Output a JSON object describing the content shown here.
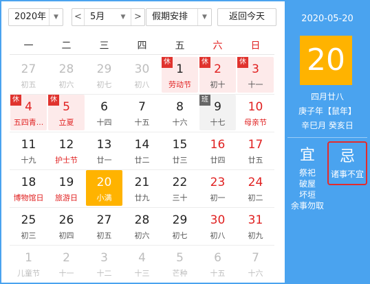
{
  "toolbar": {
    "year": "2020年",
    "prev": "<",
    "month": "5月",
    "next": ">",
    "holiday": "假期安排",
    "today": "返回今天"
  },
  "weekdays": [
    "一",
    "二",
    "三",
    "四",
    "五",
    "六",
    "日"
  ],
  "days": [
    {
      "n": "27",
      "l": "初五",
      "cls": "other"
    },
    {
      "n": "28",
      "l": "初六",
      "cls": "other"
    },
    {
      "n": "29",
      "l": "初七",
      "cls": "other"
    },
    {
      "n": "30",
      "l": "初八",
      "cls": "other"
    },
    {
      "n": "1",
      "l": "劳动节",
      "cls": "rest fest",
      "badge": "休"
    },
    {
      "n": "2",
      "l": "初十",
      "cls": "rest wknd",
      "badge": "休"
    },
    {
      "n": "3",
      "l": "十一",
      "cls": "rest wknd",
      "badge": "休"
    },
    {
      "n": "4",
      "l": "五四青...",
      "cls": "rest fest wknd-num",
      "badge": "休"
    },
    {
      "n": "5",
      "l": "立夏",
      "cls": "rest fest wknd-num",
      "badge": "休"
    },
    {
      "n": "6",
      "l": "十四",
      "cls": ""
    },
    {
      "n": "7",
      "l": "十五",
      "cls": ""
    },
    {
      "n": "8",
      "l": "十六",
      "cls": ""
    },
    {
      "n": "9",
      "l": "十七",
      "cls": "work",
      "badge": "班"
    },
    {
      "n": "10",
      "l": "母亲节",
      "cls": "wknd fest"
    },
    {
      "n": "11",
      "l": "十九",
      "cls": ""
    },
    {
      "n": "12",
      "l": "护士节",
      "cls": "fest"
    },
    {
      "n": "13",
      "l": "廿一",
      "cls": ""
    },
    {
      "n": "14",
      "l": "廿二",
      "cls": ""
    },
    {
      "n": "15",
      "l": "廿三",
      "cls": ""
    },
    {
      "n": "16",
      "l": "廿四",
      "cls": "wknd"
    },
    {
      "n": "17",
      "l": "廿五",
      "cls": "wknd"
    },
    {
      "n": "18",
      "l": "博物馆日",
      "cls": "fest"
    },
    {
      "n": "19",
      "l": "旅游日",
      "cls": "fest"
    },
    {
      "n": "20",
      "l": "小满",
      "cls": "today"
    },
    {
      "n": "21",
      "l": "廿九",
      "cls": ""
    },
    {
      "n": "22",
      "l": "三十",
      "cls": ""
    },
    {
      "n": "23",
      "l": "初一",
      "cls": "wknd"
    },
    {
      "n": "24",
      "l": "初二",
      "cls": "wknd"
    },
    {
      "n": "25",
      "l": "初三",
      "cls": ""
    },
    {
      "n": "26",
      "l": "初四",
      "cls": ""
    },
    {
      "n": "27",
      "l": "初五",
      "cls": ""
    },
    {
      "n": "28",
      "l": "初六",
      "cls": ""
    },
    {
      "n": "29",
      "l": "初七",
      "cls": ""
    },
    {
      "n": "30",
      "l": "初八",
      "cls": "wknd"
    },
    {
      "n": "31",
      "l": "初九",
      "cls": "wknd"
    },
    {
      "n": "1",
      "l": "儿童节",
      "cls": "other"
    },
    {
      "n": "2",
      "l": "十一",
      "cls": "other"
    },
    {
      "n": "3",
      "l": "十二",
      "cls": "other"
    },
    {
      "n": "4",
      "l": "十三",
      "cls": "other"
    },
    {
      "n": "5",
      "l": "芒种",
      "cls": "other"
    },
    {
      "n": "6",
      "l": "十五",
      "cls": "other"
    },
    {
      "n": "7",
      "l": "十六",
      "cls": "other"
    }
  ],
  "panel": {
    "date": "2020-05-20",
    "day": "20",
    "lunar": "四月廿八",
    "ganzhi1": "庚子年【鼠年】",
    "ganzhi2": "辛巳月 癸亥日",
    "yi_title": "宜",
    "yi_items": [
      "祭祀",
      "破屋",
      "坏垣",
      "余事勿取"
    ],
    "ji_title": "忌",
    "ji_items": [
      "诸事不宜"
    ]
  },
  "colors": {
    "accent": "#4aa3ef",
    "today": "#ffb300",
    "holiday_red": "#e0332e",
    "highlight_box": "#e52a2a"
  }
}
